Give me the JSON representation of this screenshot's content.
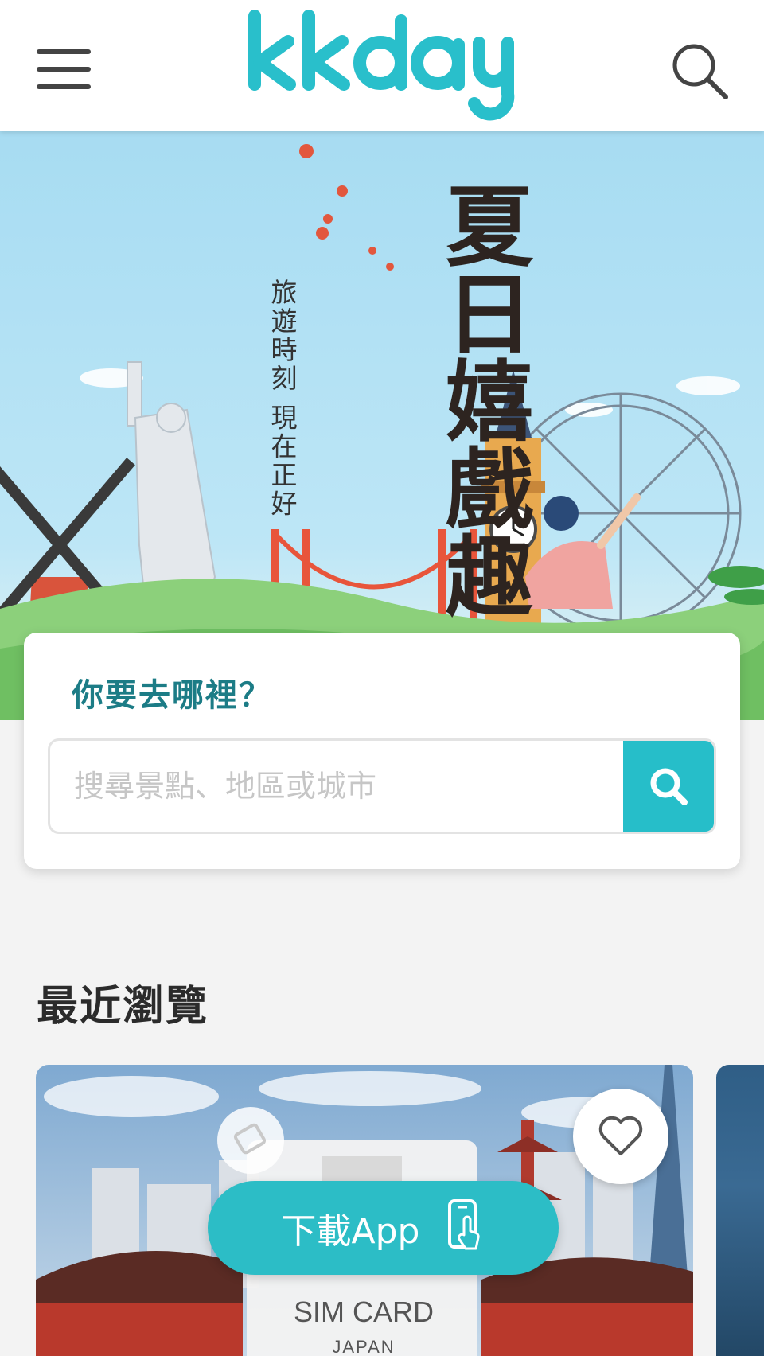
{
  "header": {
    "logo_text": "kkday",
    "menu_icon": "hamburger-menu-icon",
    "search_icon": "search-icon"
  },
  "hero": {
    "title": "夏日嬉戲趣",
    "subtitle": "旅遊時刻 現在正好",
    "slides_total": 7,
    "active_slide": 1
  },
  "search": {
    "question": "你要去哪裡？",
    "placeholder": "搜尋景點、地區或城市",
    "value": ""
  },
  "recently_viewed": {
    "title": "最近瀏覽",
    "items": [
      {
        "image_text_primary": "SIM CARD",
        "image_text_secondary": "JAPAN",
        "favorite_icon": "heart-outline-icon"
      }
    ]
  },
  "download_app": {
    "label": "下載App",
    "icon": "phone-tap-icon"
  },
  "colors": {
    "brand_teal": "#26bec9",
    "heading_teal": "#1c7c86",
    "sky_blue": "#a9dcf1"
  }
}
